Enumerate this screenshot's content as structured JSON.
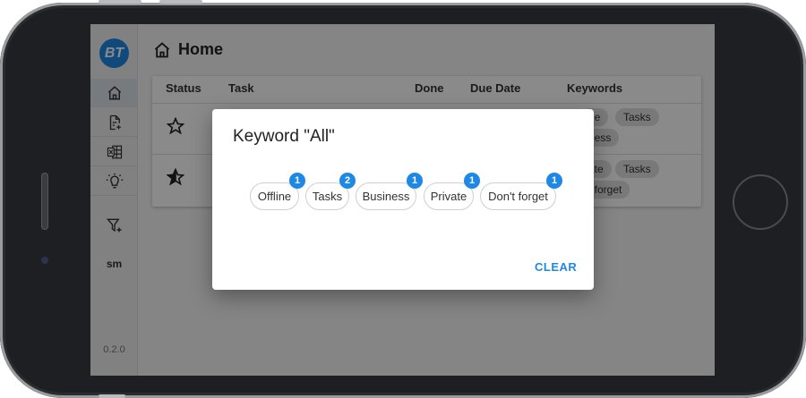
{
  "app": {
    "logo_text": "BT",
    "version": "0.2.0"
  },
  "rail": {
    "items": [
      {
        "icon": "home-icon",
        "active": true
      },
      {
        "icon": "add-document-icon"
      },
      {
        "icon": "excel-icon"
      },
      {
        "icon": "lightbulb-icon"
      },
      {
        "icon": "filter-add-icon"
      }
    ],
    "size_label": "sm"
  },
  "header": {
    "title": "Home",
    "icon": "home-icon"
  },
  "table": {
    "columns": [
      "Status",
      "Task",
      "Done",
      "Due Date",
      "Keywords"
    ],
    "rows": [
      {
        "status_icon": "star-outline-icon",
        "keywords_visible": [
          "ne",
          "Tasks",
          "ness"
        ]
      },
      {
        "status_icon": "star-half-icon",
        "keywords_visible": [
          "ate",
          "Tasks",
          "t forget"
        ]
      }
    ]
  },
  "dialog": {
    "title": "Keyword \"All\"",
    "keywords": [
      {
        "label": "Offline",
        "count": "1"
      },
      {
        "label": "Tasks",
        "count": "2"
      },
      {
        "label": "Business",
        "count": "1"
      },
      {
        "label": "Private",
        "count": "1"
      },
      {
        "label": "Don't forget",
        "count": "1"
      }
    ],
    "clear_label": "CLEAR"
  },
  "colors": {
    "accent": "#1e88e5",
    "overlay": "rgba(0,0,0,0.46)"
  }
}
